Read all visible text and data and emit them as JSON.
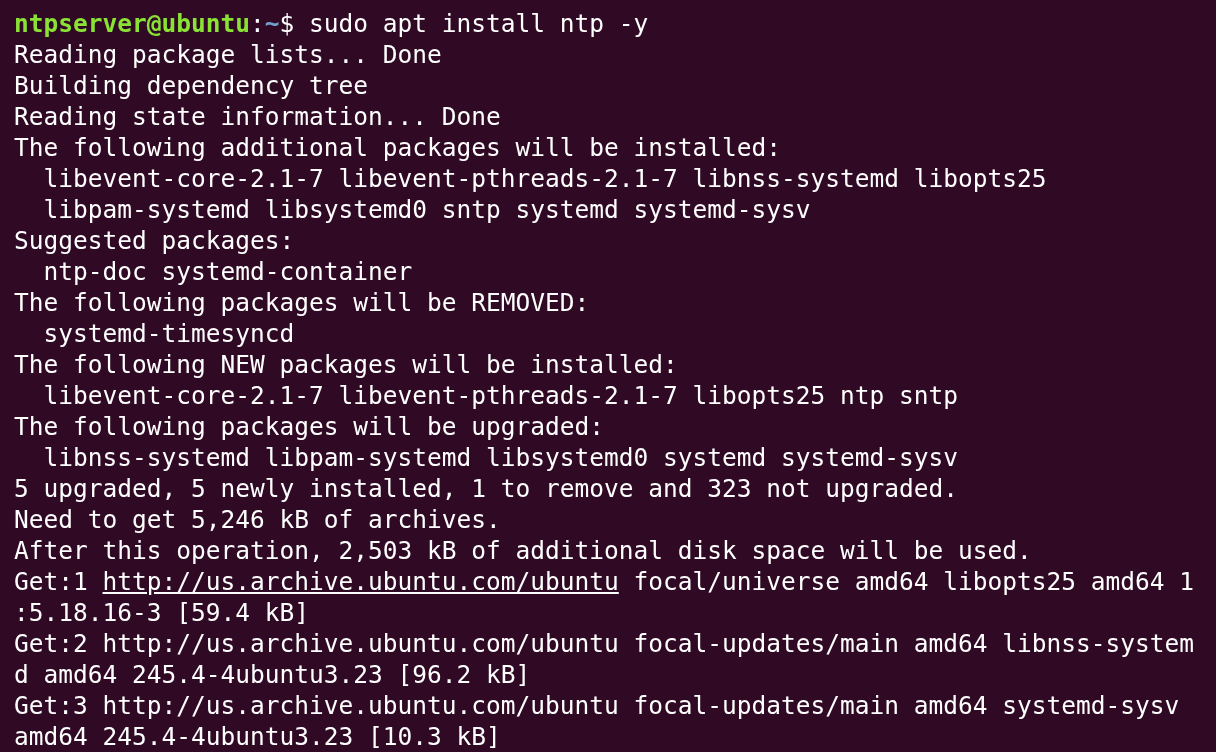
{
  "prompt": {
    "user_host": "ntpserver@ubuntu",
    "separator": ":",
    "path": "~",
    "symbol": "$",
    "command": "sudo apt install ntp -y"
  },
  "lines": [
    {
      "kind": "text",
      "text": "Reading package lists... Done"
    },
    {
      "kind": "text",
      "text": "Building dependency tree"
    },
    {
      "kind": "text",
      "text": "Reading state information... Done"
    },
    {
      "kind": "text",
      "text": "The following additional packages will be installed:"
    },
    {
      "kind": "text",
      "text": "  libevent-core-2.1-7 libevent-pthreads-2.1-7 libnss-systemd libopts25"
    },
    {
      "kind": "text",
      "text": "  libpam-systemd libsystemd0 sntp systemd systemd-sysv"
    },
    {
      "kind": "text",
      "text": "Suggested packages:"
    },
    {
      "kind": "text",
      "text": "  ntp-doc systemd-container"
    },
    {
      "kind": "text",
      "text": "The following packages will be REMOVED:"
    },
    {
      "kind": "text",
      "text": "  systemd-timesyncd"
    },
    {
      "kind": "text",
      "text": "The following NEW packages will be installed:"
    },
    {
      "kind": "text",
      "text": "  libevent-core-2.1-7 libevent-pthreads-2.1-7 libopts25 ntp sntp"
    },
    {
      "kind": "text",
      "text": "The following packages will be upgraded:"
    },
    {
      "kind": "text",
      "text": "  libnss-systemd libpam-systemd libsystemd0 systemd systemd-sysv"
    },
    {
      "kind": "text",
      "text": "5 upgraded, 5 newly installed, 1 to remove and 323 not upgraded."
    },
    {
      "kind": "text",
      "text": "Need to get 5,246 kB of archives."
    },
    {
      "kind": "text",
      "text": "After this operation, 2,503 kB of additional disk space will be used."
    },
    {
      "kind": "link",
      "prefix": "Get:1 ",
      "link": "http://us.archive.ubuntu.com/ubuntu",
      "suffix": " focal/universe amd64 libopts25 amd64 1"
    },
    {
      "kind": "text",
      "text": ":5.18.16-3 [59.4 kB]"
    },
    {
      "kind": "text",
      "text": "Get:2 http://us.archive.ubuntu.com/ubuntu focal-updates/main amd64 libnss-system"
    },
    {
      "kind": "text",
      "text": "d amd64 245.4-4ubuntu3.23 [96.2 kB]"
    },
    {
      "kind": "text",
      "text": "Get:3 http://us.archive.ubuntu.com/ubuntu focal-updates/main amd64 systemd-sysv"
    },
    {
      "kind": "text",
      "text": "amd64 245.4-4ubuntu3.23 [10.3 kB]"
    }
  ]
}
